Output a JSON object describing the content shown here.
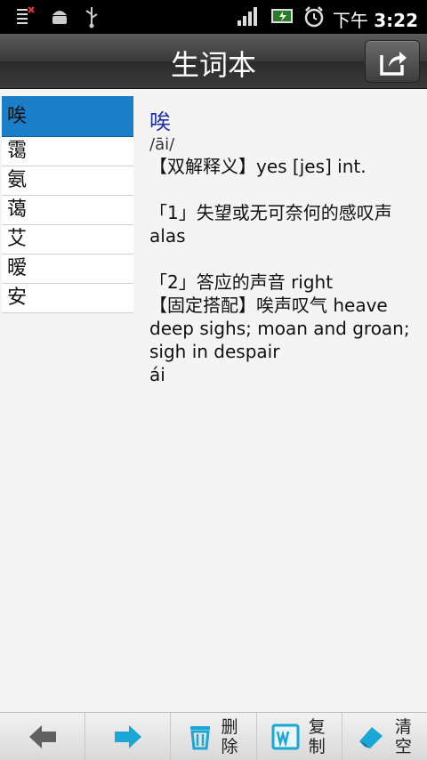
{
  "status": {
    "time_prefix": "下午",
    "time": "3:22"
  },
  "header": {
    "title": "生词本"
  },
  "wordlist": {
    "items": [
      "唉",
      "霭",
      "氨",
      "蔼",
      "艾",
      "暧",
      "安"
    ],
    "selected_index": 0
  },
  "detail": {
    "headword": "唉",
    "phonetic": "/āi/",
    "lines": [
      "【双解释义】yes [jes] int.",
      "",
      "「1」失望或无可奈何的感叹声",
      "alas",
      "",
      "「2」答应的声音 right",
      "【固定搭配】唉声叹气 heave deep sighs; moan and groan; sigh in despair",
      "ái"
    ]
  },
  "toolbar": {
    "delete_label": "删除",
    "copy_label": "复制",
    "clear_label": "清空"
  },
  "colors": {
    "selected": "#1a7ec8",
    "headword": "#1f2fa8",
    "forward_arrow": "#1aa7d6"
  }
}
